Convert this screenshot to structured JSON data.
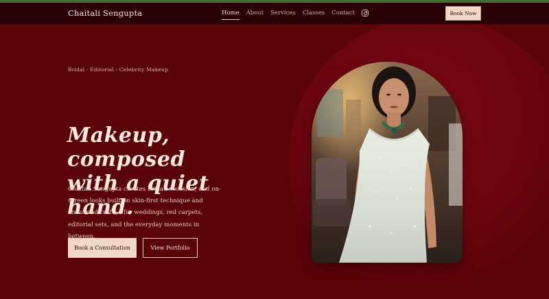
{
  "brand": "Chaitali Sengupta",
  "nav": {
    "links": [
      "Home",
      "About",
      "Services",
      "Classes",
      "Contact"
    ],
    "active": "Home",
    "book_label": "Book Now"
  },
  "hero": {
    "eyebrow": "Bridal · Editorial · Celebrity Makeup",
    "headline_line1": "Makeup, composed",
    "headline_line2": "with a quiet hand.",
    "description": "Chaitali Sengupta creates bridal, occasion, and on-screen looks built on skin-first technique and unhurried craft — for weddings, red carpets, editorial sets, and the everyday moments in between.",
    "primary_cta": "Book a Consultation",
    "secondary_cta": "View Portfolio"
  },
  "colors": {
    "background": "#5a0309",
    "navbar": "#2a0105",
    "accent": "#efd9c6",
    "top_strip": "#3f6f2e"
  },
  "icons": {
    "social": "instagram-icon"
  }
}
